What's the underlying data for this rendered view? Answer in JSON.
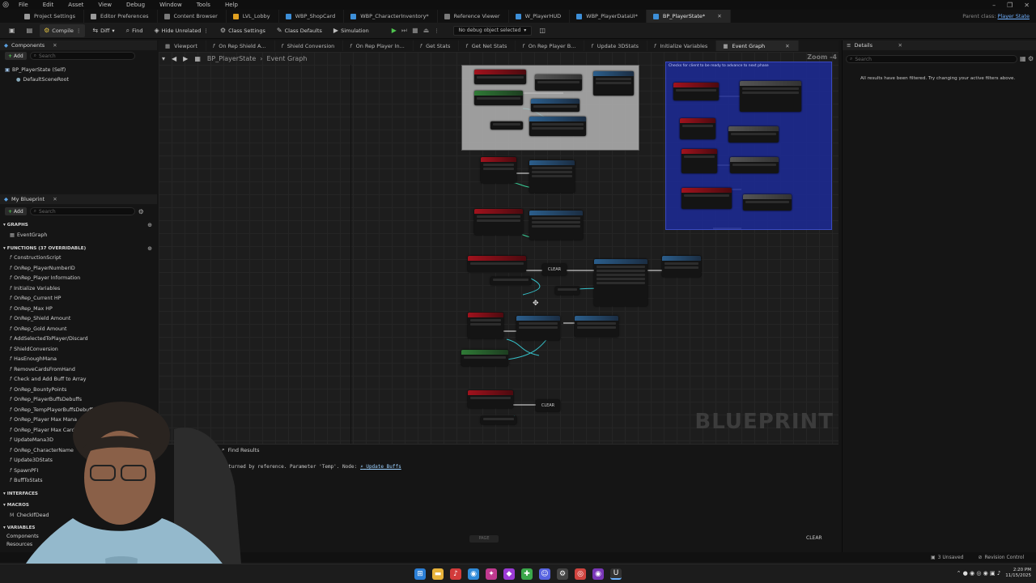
{
  "menu": {
    "items": [
      "File",
      "Edit",
      "Asset",
      "View",
      "Debug",
      "Window",
      "Tools",
      "Help"
    ],
    "window_controls": [
      "–",
      "❐",
      "✕"
    ]
  },
  "tabs": [
    {
      "label": "Project Settings",
      "color": "#9a9a9a"
    },
    {
      "label": "Editor Preferences",
      "color": "#9a9a9a"
    },
    {
      "label": "Content Browser",
      "color": "#7a7a7a"
    },
    {
      "label": "LVL_Lobby",
      "color": "#e0a020"
    },
    {
      "label": "WBP_ShopCard",
      "color": "#3d8fd8"
    },
    {
      "label": "WBP_CharacterInventory*",
      "color": "#3d8fd8"
    },
    {
      "label": "Reference Viewer",
      "color": "#7a7a7a"
    },
    {
      "label": "W_PlayerHUD",
      "color": "#3d8fd8"
    },
    {
      "label": "WBP_PlayerDataUI*",
      "color": "#3d8fd8"
    },
    {
      "label": "BP_PlayerState*",
      "color": "#3d8fd8",
      "active": true
    }
  ],
  "parent_class": {
    "label": "Parent class:",
    "value": "Player State"
  },
  "toolbar": {
    "compile": "Compile",
    "diff": "Diff",
    "find": "Find",
    "hide_unrelated": "Hide Unrelated",
    "class_settings": "Class Settings",
    "class_defaults": "Class Defaults",
    "simulation": "Simulation",
    "debug_object": "No debug object selected"
  },
  "components": {
    "title": "Components",
    "add": "Add",
    "search_placeholder": "Search",
    "items": [
      "BP_PlayerState (Self)",
      "DefaultSceneRoot"
    ]
  },
  "my_blueprint": {
    "title": "My Blueprint",
    "add": "Add",
    "search_placeholder": "Search",
    "graphs_label": "GRAPHS",
    "event_graph": "EventGraph",
    "functions_label": "FUNCTIONS (37 OVERRIDABLE)",
    "functions": [
      "ConstructionScript",
      "OnRep_PlayerNumberID",
      "OnRep_Player Information",
      "Initialize Variables",
      "OnRep_Current HP",
      "OnRep_Max HP",
      "OnRep_Shield Amount",
      "OnRep_Gold Amount",
      "AddSelectedToPlayer/Discard",
      "ShieldConversion",
      "HasEnoughMana",
      "RemoveCardsFromHand",
      "Check and Add Buff to Array",
      "OnRep_BountyPoints",
      "OnRep_PlayerBuffsDebuffs",
      "OnRep_TempPlayerBuffsDebuffs",
      "OnRep_Player Max Mana",
      "OnRep_Player Max Card In Hand",
      "UpdateMana3D",
      "OnRep_CharacterName",
      "Update3DStats",
      "SpawnPFI",
      "BuffToStats"
    ],
    "interfaces_label": "INTERFACES",
    "macros_label": "MACROS",
    "macro_item": "CheckIfDead",
    "variables_label": "VARIABLES",
    "components_label": "Components",
    "resources_label": "Resources"
  },
  "graph_tabs": [
    "Viewport",
    "On Rep Shield A...",
    "Shield Conversion",
    "On Rep Player In...",
    "Get Stats",
    "Get Net Stats",
    "On Rep Player B...",
    "Update 3DStats",
    "Initialize Variables",
    "Event Graph"
  ],
  "breadcrumb": {
    "blueprint": "BP_PlayerState",
    "sep": "›",
    "graph": "Event Graph"
  },
  "zoom": "Zoom -4",
  "comment_text": "Checks for client to be ready to advance to next phase",
  "clear_labels": [
    "CLEAR",
    "CLEAR"
  ],
  "watermark": "BLUEPRINT",
  "details": {
    "title": "Details",
    "search_placeholder": "Search",
    "empty_message": "All results have been filtered. Try changing your active filters above."
  },
  "find_results": {
    "title": "Find Results",
    "message": "will be returned by reference. Parameter 'Temp'. Node:",
    "link": "Update Buffs",
    "page": "PAGE",
    "clear": "CLEAR"
  },
  "status": {
    "unsaved": "3 Unsaved",
    "revision": "Revision Control"
  },
  "clock": {
    "time": "2:20 PM",
    "date": "11/15/2025"
  }
}
